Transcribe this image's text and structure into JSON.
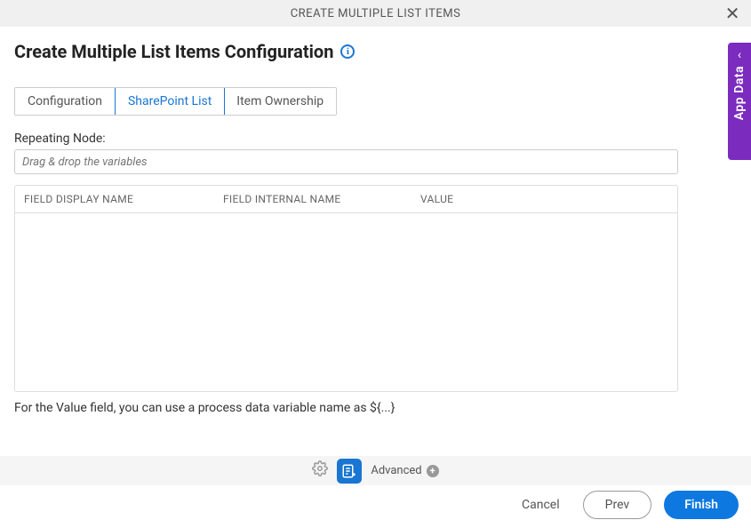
{
  "header": {
    "title": "CREATE MULTIPLE LIST ITEMS"
  },
  "page": {
    "title": "Create Multiple List Items Configuration"
  },
  "tabs": [
    {
      "label": "Configuration",
      "active": false
    },
    {
      "label": "SharePoint List",
      "active": true
    },
    {
      "label": "Item Ownership",
      "active": false
    }
  ],
  "repeating_node": {
    "label": "Repeating Node:",
    "placeholder": "Drag & drop the variables"
  },
  "table": {
    "headers": [
      "FIELD DISPLAY NAME",
      "FIELD INTERNAL NAME",
      "VALUE"
    ],
    "rows": []
  },
  "helper_text": "For the Value field, you can use a process data variable name as ${...}",
  "toolbar": {
    "advanced_label": "Advanced"
  },
  "footer": {
    "cancel": "Cancel",
    "prev": "Prev",
    "finish": "Finish"
  },
  "side_panel": {
    "label": "App Data"
  }
}
